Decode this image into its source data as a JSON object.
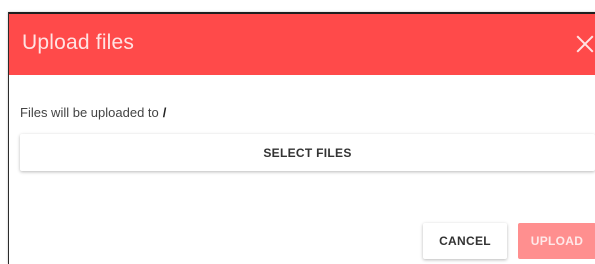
{
  "dialog": {
    "title": "Upload files",
    "close_icon": "close-icon",
    "header_color": "#ff4a4a"
  },
  "body": {
    "destination_label": "Files will be uploaded to",
    "destination_path": "/",
    "select_files_label": "SELECT FILES"
  },
  "actions": {
    "cancel_label": "CANCEL",
    "upload_label": "UPLOAD",
    "upload_disabled": true
  }
}
